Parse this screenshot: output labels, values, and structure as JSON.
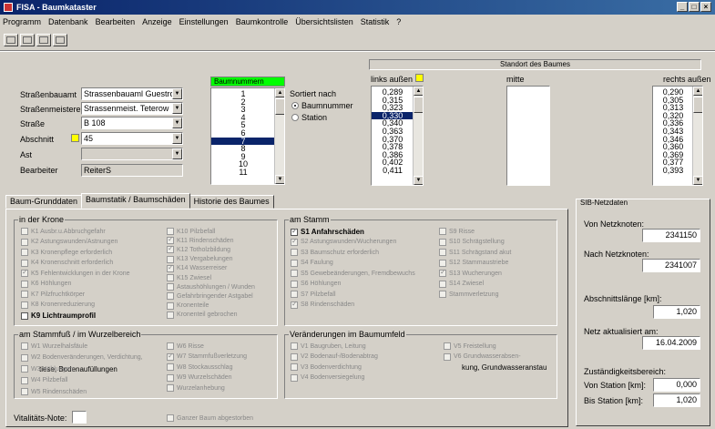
{
  "window": {
    "title": "FISA - Baumkataster"
  },
  "menu": [
    "Programm",
    "Datenbank",
    "Bearbeiten",
    "Anzeige",
    "Einstellungen",
    "Baumkontrolle",
    "Übersichtslisten",
    "Statistik",
    "?"
  ],
  "form": {
    "strassenbauamt_label": "Straßenbauamt",
    "strassenbauamt_value": "Strassenbauaml Guestrow",
    "strassenmeisterei_label": "Straßenmeisterei",
    "strassenmeisterei_value": "Strassenmeist. Teterow",
    "strasse_label": "Straße",
    "strasse_value": "B 108",
    "abschnitt_label": "Abschnitt",
    "abschnitt_value": "45",
    "ast_label": "Ast",
    "ast_value": "",
    "bearbeiter_label": "Bearbeiter",
    "bearbeiter_value": "ReiterS"
  },
  "baumnummern": {
    "header": "Baumnummern",
    "items": [
      "1",
      "2",
      "3",
      "4",
      "5",
      "6",
      "7",
      "8",
      "9",
      "10",
      "11"
    ],
    "selected_index": 6
  },
  "sortiert": {
    "label": "Sortiert nach",
    "options": [
      "Baumnummer",
      "Station"
    ],
    "selected": 0
  },
  "standort": {
    "header": "Standort des Baumes",
    "links_label": "links außen",
    "mitte_label": "mitte",
    "rechts_label": "rechts außen",
    "links_values": [
      "0,289",
      "0,315",
      "0,323",
      "0,330",
      "0,340",
      "0,363",
      "0,370",
      "0,378",
      "0,386",
      "0,402",
      "0,411"
    ],
    "links_selected_index": 3,
    "rechts_values": [
      "0,290",
      "0,305",
      "0,313",
      "0,320",
      "0,336",
      "0,343",
      "0,346",
      "0,360",
      "0,369",
      "0,377",
      "0,393"
    ]
  },
  "tabs": [
    "Baum-Grunddaten",
    "Baumstatik / Baumschäden",
    "Historie des Baumes"
  ],
  "active_tab": 1,
  "krone": {
    "legend": "in der Krone",
    "col1": [
      {
        "label": "K1 Ausbr.u.Abbruchgefahr",
        "checked": false
      },
      {
        "label": "K2 Astungswunden/Astnungen",
        "checked": false
      },
      {
        "label": "K3 Kronenpflege erforderlich",
        "checked": false
      },
      {
        "label": "K4 Kronenschnitt erforderlich",
        "checked": false
      },
      {
        "label": "K5 Fehlentwicklungen in der Krone",
        "checked": true
      },
      {
        "label": "K6 Höhlungen",
        "checked": false
      },
      {
        "label": "K7 Pilzfruchtkörper",
        "checked": false
      },
      {
        "label": "K8 Kronenreduzierung",
        "checked": false
      },
      {
        "label": "K9 Lichtraumprofil",
        "checked": false,
        "active": true
      }
    ],
    "col2": [
      {
        "label": "K10 Pilzbefall",
        "checked": false
      },
      {
        "label": "K11 Rindenschäden",
        "checked": true
      },
      {
        "label": "K12 Totholzbildung",
        "checked": true
      },
      {
        "label": "K13 Vergabelungen",
        "checked": false
      },
      {
        "label": "K14 Wasserreiser",
        "checked": true
      },
      {
        "label": "K15 Zwiesel",
        "checked": false
      },
      {
        "label": "Astaushöhlungen / Wunden",
        "checked": false
      },
      {
        "label": "Gefahrbringender Astgabel",
        "checked": false
      },
      {
        "label": "Kronenteile",
        "checked": false
      },
      {
        "label": "Kronenteil gebrochen",
        "checked": false
      }
    ]
  },
  "stamm": {
    "legend": "am Stamm",
    "col1": [
      {
        "label": "S1 Anfahrschäden",
        "checked": true,
        "active": true
      },
      {
        "label": "S2 Astungswunden/Wucherungen",
        "checked": true
      },
      {
        "label": "S3 Baumschutz erforderlich",
        "checked": false
      },
      {
        "label": "S4 Faulung",
        "checked": false
      },
      {
        "label": "S5 Gewebeänderungen, Fremdbewuchs",
        "checked": false
      },
      {
        "label": "S6 Höhlungen",
        "checked": false
      },
      {
        "label": "S7 Pilzbefall",
        "checked": false
      },
      {
        "label": "S8 Rindenschäden",
        "checked": true
      }
    ],
    "col2": [
      {
        "label": "S9 Risse",
        "checked": false
      },
      {
        "label": "S10 Schrägstellung",
        "checked": false
      },
      {
        "label": "S11 Schrägstand akut",
        "checked": false
      },
      {
        "label": "S12 Stammaustriebe",
        "checked": false
      },
      {
        "label": "S13 Wucherungen",
        "checked": true
      },
      {
        "label": "S14 Zwiesel",
        "checked": false
      },
      {
        "label": "Stammverletzung",
        "checked": false
      }
    ]
  },
  "stammfuss": {
    "legend": "am Stammfuß / im Wurzelbereich",
    "col1": [
      {
        "label": "W1 Wurzelhalsfäule",
        "checked": false
      },
      {
        "label": "W2 Bodenveränderungen, Verdichtung,",
        "checked": false,
        "extra": "tiese, Bodenaufüllungen"
      },
      {
        "label": "W3 Höhlungen",
        "checked": false
      },
      {
        "label": "W4 Pilzbefall",
        "checked": false
      },
      {
        "label": "W5 Rindenschäden",
        "checked": false
      }
    ],
    "col2": [
      {
        "label": "W6 Risse",
        "checked": false
      },
      {
        "label": "W7 Stammfußverletzung",
        "checked": true
      },
      {
        "label": "W8 Stockausschlag",
        "checked": false
      },
      {
        "label": "W9 Wurzelschäden",
        "checked": false
      },
      {
        "label": "Wurzelanhebung",
        "checked": false
      }
    ]
  },
  "umfeld": {
    "legend": "Veränderungen im Baumumfeld",
    "col1": [
      {
        "label": "V1 Baugruben, Leitung",
        "checked": false
      },
      {
        "label": "V2 Bodenauf-/Bodenabtrag",
        "checked": false
      },
      {
        "label": "V3 Bodenverdichtung",
        "checked": false
      },
      {
        "label": "V4 Bodenversiegelung",
        "checked": false
      }
    ],
    "col2": [
      {
        "label": "V5 Freistellung",
        "checked": false
      },
      {
        "label": "V6 Grundwasserabsen-",
        "checked": false,
        "extra": "kung, Grundwasseranstau"
      }
    ]
  },
  "vitalitaet_label": "Vitalitäts-Note:",
  "vitalitaet_value": "",
  "ganzer_baum_label": "Ganzer Baum abgestorben",
  "sib": {
    "legend": "SIB-Netzdaten",
    "von_label": "Von Netzknoten:",
    "von_value": "2341150",
    "nach_label": "Nach Netzknoten:",
    "nach_value": "2341007",
    "laenge_label": "Abschnittslänge [km]:",
    "laenge_value": "1,020",
    "aktualisiert_label": "Netz aktualisiert am:",
    "aktualisiert_value": "16.04.2009",
    "zustaendig_label": "Zuständigkeitsbereich:",
    "vonstation_label": "Von Station [km]:",
    "vonstation_value": "0,000",
    "bisstation_label": "Bis Station [km]:",
    "bisstation_value": "1,020"
  }
}
